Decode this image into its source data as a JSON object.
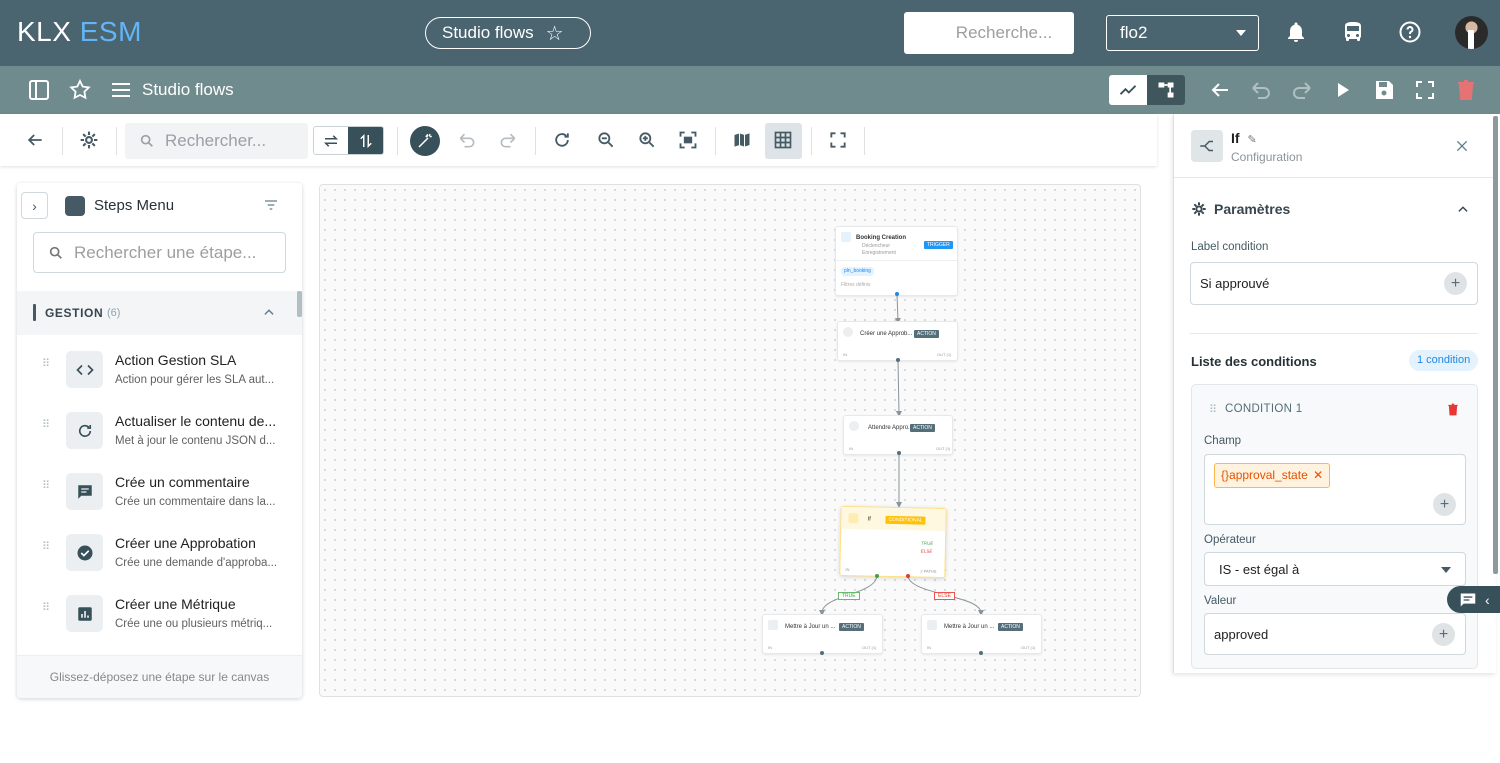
{
  "app": {
    "logo_part1": "KLX",
    "logo_part2": "ESM",
    "flow_pill_label": "Studio flows",
    "search_placeholder": "Recherche...",
    "environment": "flo2"
  },
  "subbar": {
    "title": "Studio flows"
  },
  "toolbar": {
    "search_placeholder": "Rechercher..."
  },
  "steps_menu": {
    "title": "Steps Menu",
    "search_placeholder": "Rechercher une étape...",
    "group": {
      "label": "GESTION",
      "count": "(6)"
    },
    "items": [
      {
        "name": "Action Gestion SLA",
        "desc": "Action pour gérer les SLA aut...",
        "icon": "code-icon"
      },
      {
        "name": "Actualiser le contenu de...",
        "desc": "Met à jour le contenu JSON d...",
        "icon": "refresh-icon"
      },
      {
        "name": "Crée un commentaire",
        "desc": "Crée un commentaire dans la...",
        "icon": "comment-icon"
      },
      {
        "name": "Créer une Approbation",
        "desc": "Crée une demande d'approba...",
        "icon": "check-circle-icon"
      },
      {
        "name": "Créer une Métrique",
        "desc": "Crée une ou plusieurs métriq...",
        "icon": "chart-icon"
      }
    ],
    "footer": "Glissez-déposez une étape sur le canvas"
  },
  "canvas": {
    "nodes": {
      "trigger": {
        "title": "Booking Creation",
        "sub1": "Déclencheur",
        "sub2": "Enregistrement",
        "tag": "TRIGGER",
        "table": "pln_booking",
        "filter": "Filtres définis"
      },
      "approval": {
        "title": "Créer une Approb...",
        "tag": "ACTION",
        "in": "IN",
        "out": "OUT (1)"
      },
      "wait": {
        "title": "Attendre Appro...",
        "tag": "ACTION",
        "in": "IN",
        "out": "OUT (1)"
      },
      "if": {
        "title": "If",
        "tag": "CONDITIONAL",
        "true": "TRUE",
        "else": "ELSE",
        "in": "IN",
        "out": "2 PATHS"
      },
      "update_true": {
        "title": "Mettre à Jour un ...",
        "tag": "ACTION",
        "in": "IN",
        "out": "OUT (1)"
      },
      "update_else": {
        "title": "Mettre à Jour un ...",
        "tag": "ACTION",
        "in": "IN",
        "out": "OUT (1)"
      }
    },
    "edge_true": "TRUE",
    "edge_else": "ELSE"
  },
  "panel": {
    "title": "If",
    "subtitle": "Configuration",
    "section_title": "Paramètres",
    "label_condition_label": "Label condition",
    "label_condition_value": "Si approuvé",
    "conditions_title": "Liste des conditions",
    "conditions_badge": "1 condition",
    "condition": {
      "title": "CONDITION 1",
      "field_label": "Champ",
      "field_chip": "{}approval_state",
      "operator_label": "Opérateur",
      "operator_value": "IS - est égal à",
      "value_label": "Valeur",
      "value": "approved"
    }
  },
  "colors": {
    "topbar": "#4a6470",
    "subbar": "#6f8b8e",
    "accent": "#37505a",
    "logo_accent": "#64b5f6",
    "delete": "#e53935",
    "conditional": "#ffc107"
  }
}
